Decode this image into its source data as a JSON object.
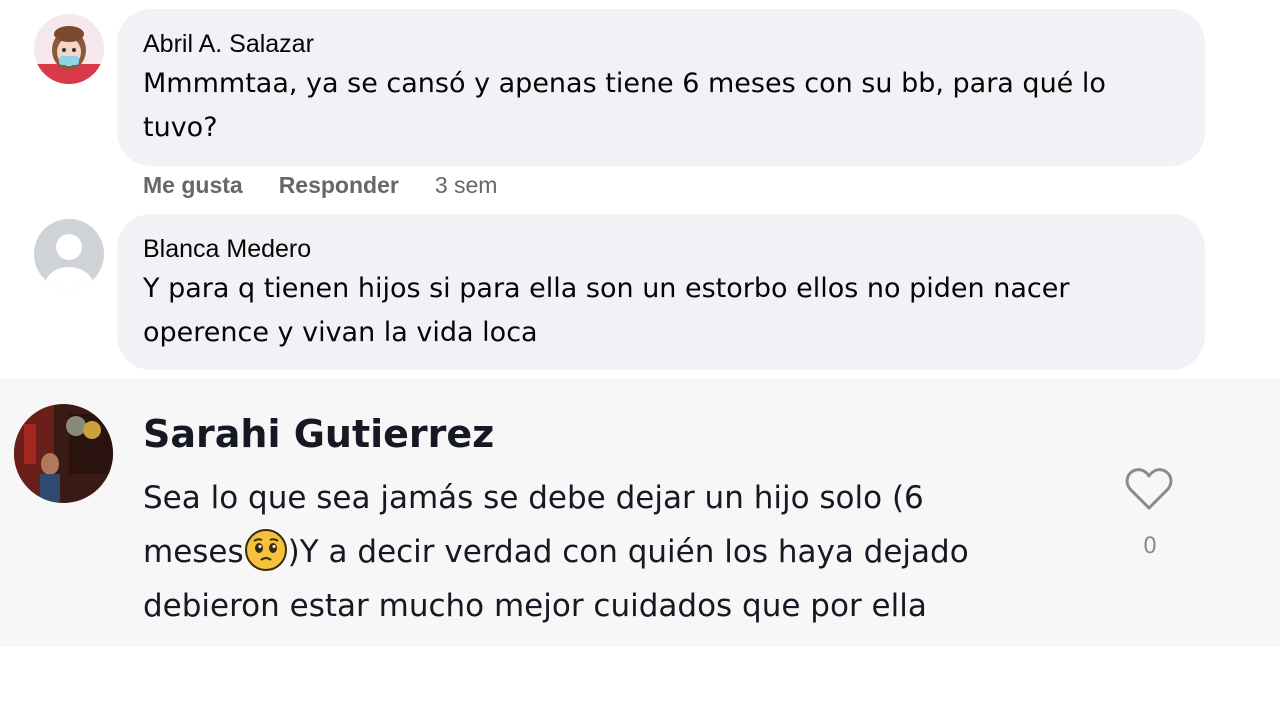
{
  "comments": [
    {
      "author": "Abril A. Salazar",
      "text_lines": [
        "Mmmmtaa, ya se cansó y apenas tiene 6 meses con su bb, para qué lo",
        "tuvo?"
      ],
      "actions": {
        "like": "Me gusta",
        "reply": "Responder",
        "time": "3 sem"
      }
    },
    {
      "author": "Blanca Medero",
      "text_lines": [
        "Y para q tienen hijos si para ella son un estorbo ellos no piden nacer",
        "operence y vivan la vida loca"
      ]
    }
  ],
  "tiktok_comment": {
    "author": "Sarahi Gutierrez",
    "line1": "Sea lo que sea jamás se debe dejar un hijo solo (6",
    "line2_before": "meses",
    "line2_after": ")Y a decir verdad con quién los haya dejado",
    "line3": "debieron estar mucho mejor cuidados que por ella",
    "emoji": "pleading-face",
    "likes": "0"
  },
  "colors": {
    "bubble": "#f0f2f5",
    "secondary_text": "#65676b",
    "tiktok_panel": "#f7f7f7",
    "heart": "#8a8b91"
  }
}
